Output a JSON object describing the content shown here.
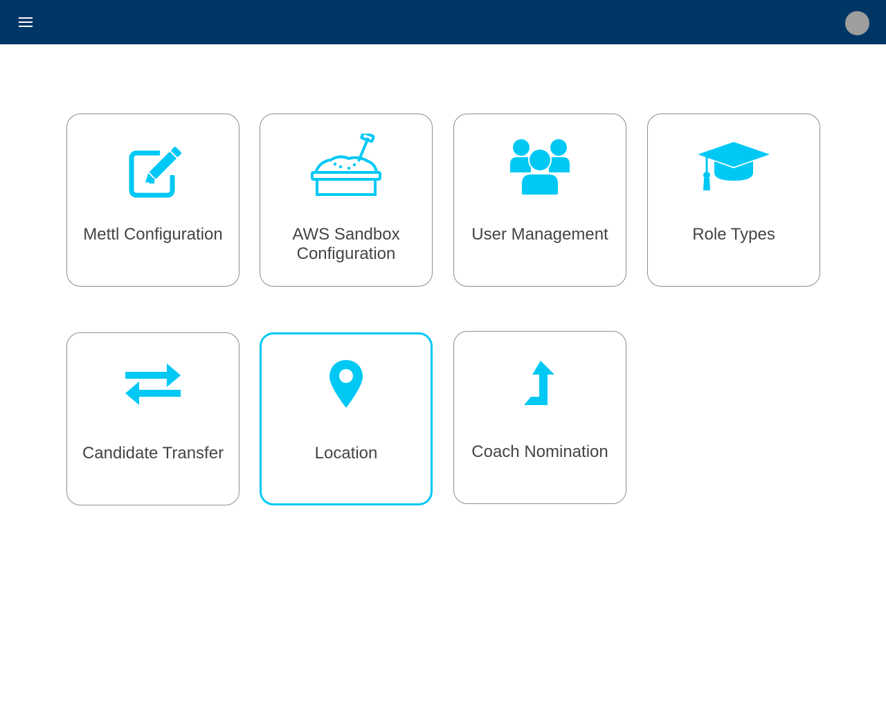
{
  "header": {
    "menu_icon": "hamburger-menu-icon",
    "avatar_icon": "user-avatar"
  },
  "accent_color": "#00c8f5",
  "header_color": "#003666",
  "tiles": [
    {
      "label": "Mettl Configuration",
      "icon": "edit-icon",
      "selected": false
    },
    {
      "label": "AWS Sandbox Configuration",
      "icon": "sandbox-icon",
      "selected": false
    },
    {
      "label": "User Management",
      "icon": "users-icon",
      "selected": false
    },
    {
      "label": "Role Types",
      "icon": "graduation-cap-icon",
      "selected": false
    },
    {
      "label": "Candidate Transfer",
      "icon": "transfer-icon",
      "selected": false
    },
    {
      "label": "Location",
      "icon": "location-pin-icon",
      "selected": true
    },
    {
      "label": "Coach Nomination",
      "icon": "nomination-arrow-icon",
      "selected": false
    }
  ]
}
